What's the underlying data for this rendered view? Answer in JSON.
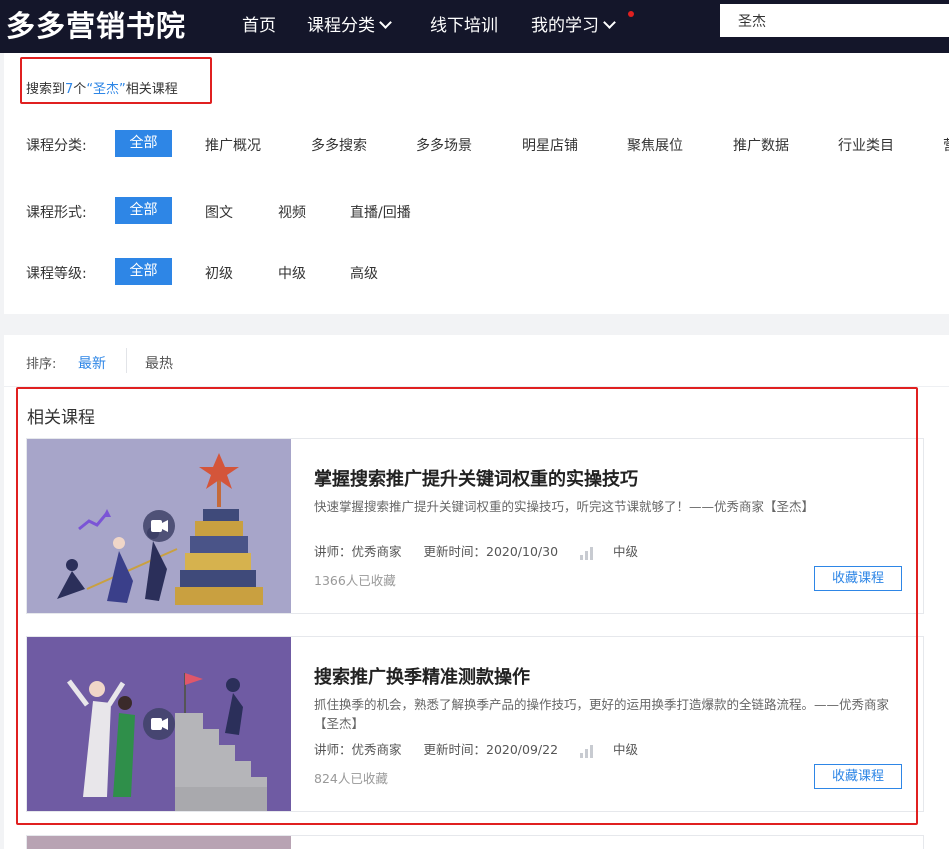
{
  "brand": {
    "logo_text": "多多营销书院"
  },
  "nav": {
    "items": [
      {
        "label": "首页"
      },
      {
        "label": "课程分类"
      },
      {
        "label": "线下培训"
      },
      {
        "label": "我的学习"
      }
    ],
    "search_value": "圣杰",
    "colors": {
      "bg": "#14162a",
      "dot": "#e02020"
    }
  },
  "result": {
    "prefix": "搜索到",
    "count": "7",
    "middle": "个",
    "keyword": "“圣杰”",
    "suffix": "相关课程"
  },
  "filters": {
    "category": {
      "label": "课程分类:",
      "options": [
        "全部",
        "推广概况",
        "多多搜索",
        "多多场景",
        "明星店铺",
        "聚焦展位",
        "推广数据",
        "行业类目",
        "营"
      ]
    },
    "format": {
      "label": "课程形式:",
      "options": [
        "全部",
        "图文",
        "视频",
        "直播/回播"
      ]
    },
    "level": {
      "label": "课程等级:",
      "options": [
        "全部",
        "初级",
        "中级",
        "高级"
      ]
    }
  },
  "sort": {
    "label": "排序:",
    "options": [
      "最新",
      "最热"
    ],
    "active": "最新"
  },
  "section_title": "相关课程",
  "courses": [
    {
      "title": "掌握搜索推广提升关键词权重的实操技巧",
      "desc": "快速掌握搜索推广提升关键词权重的实操技巧，听完这节课就够了！——优秀商家【圣杰】",
      "teacher": "讲师：优秀商家",
      "updated": "更新时间：2020/10/30",
      "level": "中级",
      "collected": "1366人已收藏",
      "button": "收藏课程",
      "thumb_color": "#a7a5c9"
    },
    {
      "title": "搜索推广换季精准测款操作",
      "desc": "抓住换季的机会，熟悉了解换季产品的操作技巧，更好的运用换季打造爆款的全链路流程。——优秀商家【圣杰】",
      "teacher": "讲师：优秀商家",
      "updated": "更新时间：2020/09/22",
      "level": "中级",
      "collected": "824人已收藏",
      "button": "收藏课程",
      "thumb_color": "#6f5ba3"
    }
  ],
  "accent": "#2e86e6"
}
